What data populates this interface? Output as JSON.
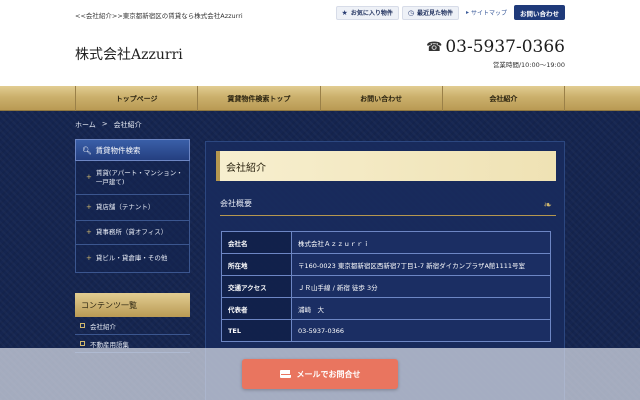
{
  "header": {
    "tagline": "<<会社紹介>>東京都新宿区の賃貸なら株式会社Azzurri",
    "favorites": "お気に入り物件",
    "recent": "最近見た物件",
    "sitemap": "サイトマップ",
    "contact": "お問い合わせ",
    "logo": "株式会社Azzurri",
    "phone": "03-5937-0366",
    "hours": "営業時間/10:00〜19:00"
  },
  "nav": {
    "items": [
      "トップページ",
      "賃貸物件検索トップ",
      "お問い合わせ",
      "会社紹介"
    ]
  },
  "breadcrumb": {
    "home": "ホーム",
    "sep": ">",
    "current": "会社紹介"
  },
  "sidebar": {
    "search_title": "賃貸物件検索",
    "items": [
      "賃貸(アパート・マンション・一戸建て)",
      "貸店舗（テナント）",
      "貸事務所（貸オフィス）",
      "貸ビル・貸倉庫・その他"
    ],
    "contents_title": "コンテンツ一覧",
    "contents": [
      "会社紹介",
      "不動産用語集"
    ]
  },
  "main": {
    "title": "会社紹介",
    "subtitle": "会社概要",
    "rows": [
      {
        "key": "会社名",
        "value": "株式会社Ａｚｚｕｒｒｉ"
      },
      {
        "key": "所在地",
        "value": "〒160-0023 東京都新宿区西新宿7丁目1-7 新宿ダイカンプラザA館1111号室"
      },
      {
        "key": "交通アクセス",
        "value": "ＪＲ山手線 / 新宿 徒歩 3分"
      },
      {
        "key": "代表者",
        "value": "浦崎　大"
      },
      {
        "key": "TEL",
        "value": "03-5937-0366"
      }
    ]
  },
  "footer": {
    "mail_button": "メールでお問合せ"
  },
  "colors": {
    "navy": "#152550",
    "gold": "#cbb06c",
    "accent": "#e9755f"
  }
}
